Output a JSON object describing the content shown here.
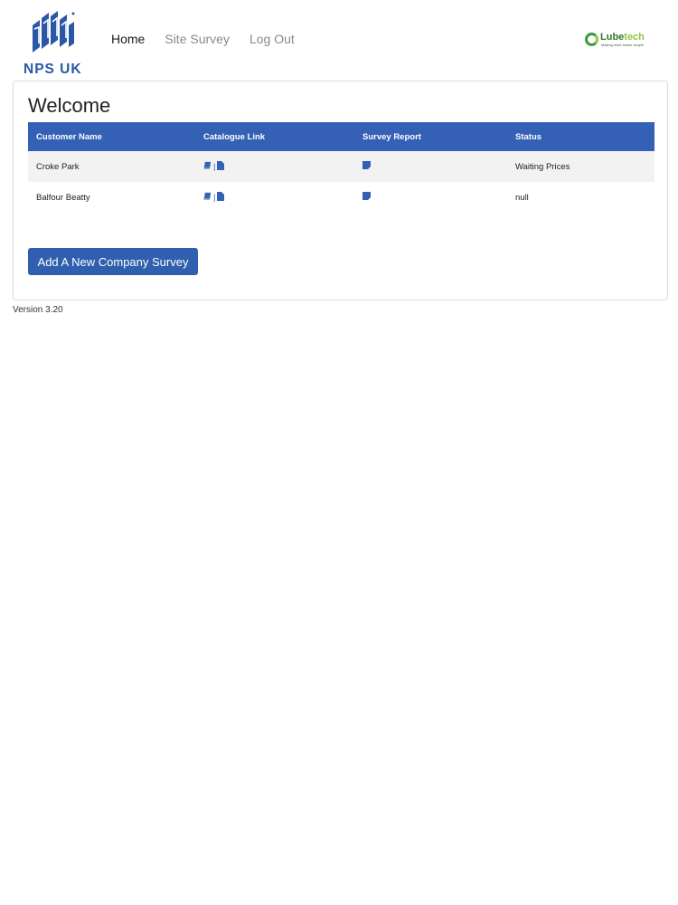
{
  "brand": {
    "name": "NPS UK",
    "logo_color": "#2a57a6"
  },
  "nav": {
    "links": [
      {
        "label": "Home",
        "active": true
      },
      {
        "label": "Site Survey",
        "active": false
      },
      {
        "label": "Log Out",
        "active": false
      }
    ]
  },
  "partner": {
    "name_part1": "Lube",
    "name_part2": "tech",
    "tagline": "Making work easier simple",
    "colors": [
      "#2b7a2b",
      "#8dc63f"
    ]
  },
  "main": {
    "title": "Welcome",
    "table": {
      "header_color": "#3461b5",
      "columns": [
        "Customer Name",
        "Catalogue Link",
        "Survey Report",
        "Status"
      ],
      "rows": [
        {
          "customer": "Croke Park",
          "catalogue_icons": [
            "book-icon",
            "file-icon"
          ],
          "catalogue_separator": "|",
          "report_icon": "report-icon",
          "status": "Waiting Prices"
        },
        {
          "customer": "Balfour Beatty",
          "catalogue_icons": [
            "book-icon",
            "file-icon"
          ],
          "catalogue_separator": "|",
          "report_icon": "report-icon",
          "status": "null"
        }
      ]
    },
    "add_button_label": "Add A New Company Survey"
  },
  "footer": {
    "version": "Version 3.20"
  }
}
